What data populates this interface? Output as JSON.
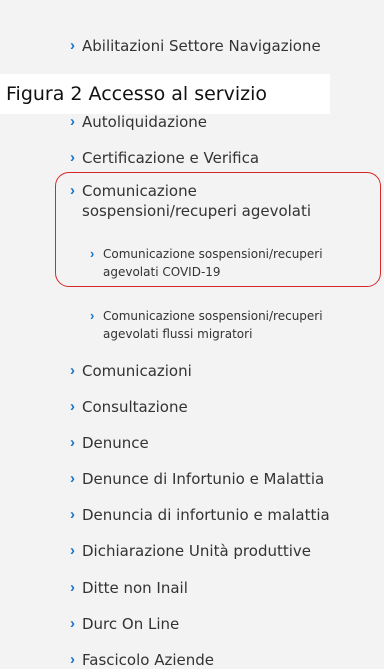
{
  "caption": "Figura 2 Accesso al servizio",
  "menu": {
    "items": [
      {
        "label": "Abilitazioni Settore Navigazione"
      },
      {
        "label": "Autoliquidazione"
      },
      {
        "label": "Certificazione e Verifica"
      },
      {
        "label": "Comunicazione sospensioni/recuperi agevolati"
      },
      {
        "label": "Comunicazione sospensioni/recuperi agevolati COVID-19"
      },
      {
        "label": "Comunicazione sospensioni/recuperi agevolati flussi migratori"
      },
      {
        "label": "Comunicazioni"
      },
      {
        "label": "Consultazione"
      },
      {
        "label": "Denunce"
      },
      {
        "label": "Denunce di Infortunio e Malattia"
      },
      {
        "label": "Denuncia di infortunio e malattia"
      },
      {
        "label": "Dichiarazione Unità produttive"
      },
      {
        "label": "Ditte non Inail"
      },
      {
        "label": "Durc On Line"
      },
      {
        "label": "Fascicolo Aziende"
      }
    ]
  },
  "icons": {
    "chevron": "›"
  },
  "colors": {
    "accent": "#1b74c6",
    "highlight_border": "#d62828",
    "panel_background": "#f3f3f3",
    "text": "#333333"
  }
}
